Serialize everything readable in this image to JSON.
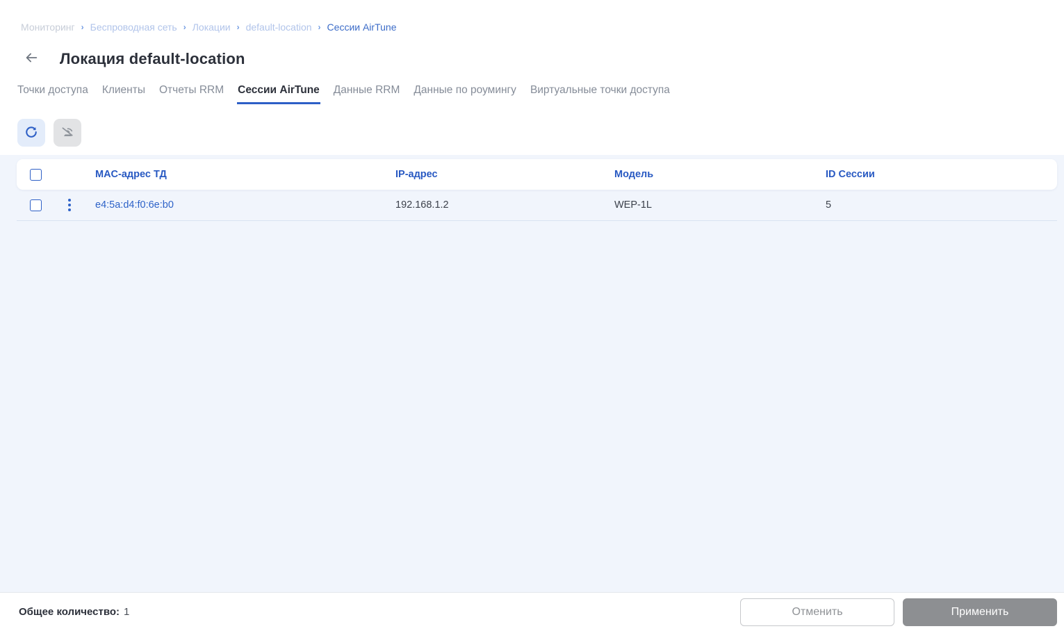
{
  "colors": {
    "accent_blue": "#2d5fc6",
    "link_blue": "#2d62c8",
    "breadcrumb_current": "#3c6cc8",
    "breadcrumb_inactive": "#b1c4ea",
    "panel_background": "#f1f5fc",
    "refresh_button_bg": "#e3ecfa",
    "disabled_button_bg": "#e2e3e5",
    "apply_button_bg": "#8d8f92",
    "tab_inactive_text": "#858c98"
  },
  "breadcrumb": {
    "items": [
      {
        "label": "Мониторинг"
      },
      {
        "label": "Беспроводная сеть"
      },
      {
        "label": "Локации"
      },
      {
        "label": "default-location"
      },
      {
        "label": "Сессии AirTune"
      }
    ],
    "separator": "›"
  },
  "header": {
    "title": "Локация default-location",
    "back_icon": "arrow-left"
  },
  "tabs": {
    "items": [
      {
        "label": "Точки доступа",
        "active": false
      },
      {
        "label": "Клиенты",
        "active": false
      },
      {
        "label": "Отчеты RRM",
        "active": false
      },
      {
        "label": "Сессии AirTune",
        "active": true
      },
      {
        "label": "Данные RRM",
        "active": false
      },
      {
        "label": "Данные по роумингу",
        "active": false
      },
      {
        "label": "Виртуальные точки доступа",
        "active": false
      }
    ]
  },
  "toolbar": {
    "buttons": [
      {
        "icon": "refresh",
        "enabled": true
      },
      {
        "icon": "wifi-off",
        "enabled": false
      }
    ]
  },
  "table": {
    "columns": [
      "MAC-адрес ТД",
      "IP-адрес",
      "Модель",
      "ID Сессии"
    ],
    "rows": [
      {
        "mac": "e4:5a:d4:f0:6e:b0",
        "ip": "192.168.1.2",
        "model": "WEP-1L",
        "session_id": "5"
      }
    ]
  },
  "footer": {
    "total_label": "Общее количество:",
    "total_value": "1",
    "cancel_label": "Отменить",
    "apply_label": "Применить"
  }
}
